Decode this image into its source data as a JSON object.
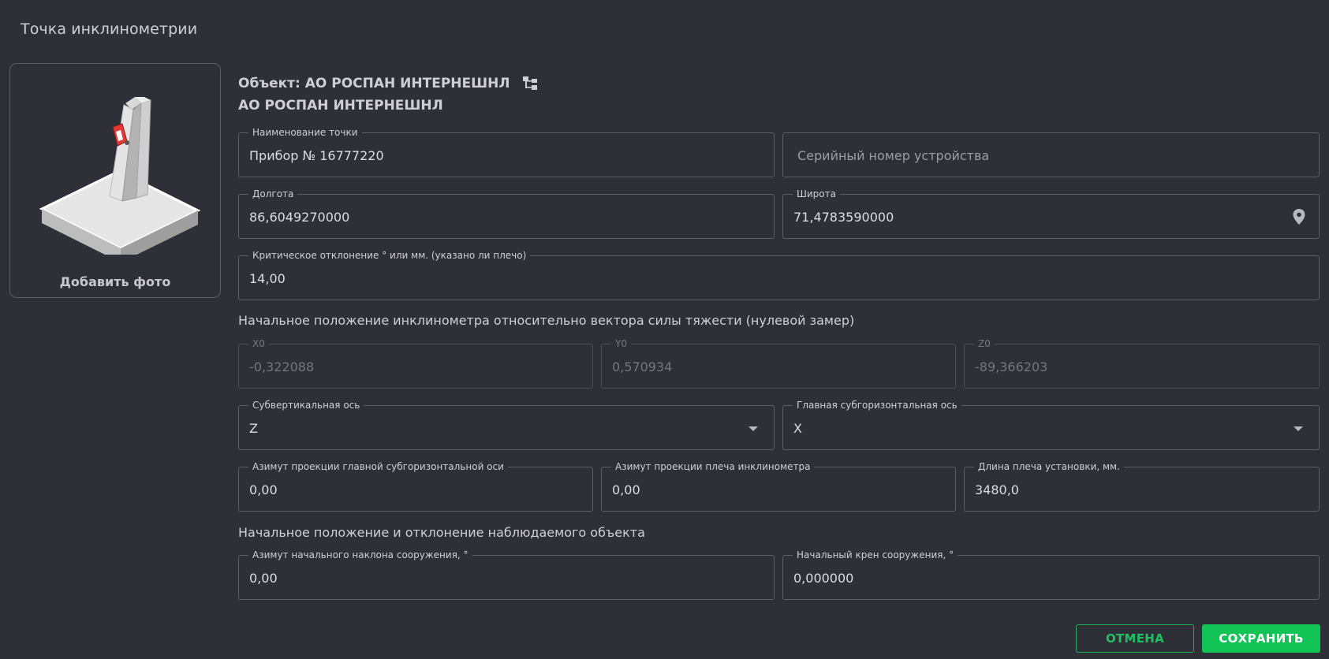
{
  "dialog": {
    "title": "Точка инклинометрии"
  },
  "photo": {
    "label": "Добавить фото"
  },
  "object": {
    "line1": "Объект: АО РОСПАН ИНТЕРНЕШНЛ",
    "line2": "АО РОСПАН ИНТЕРНЕШНЛ",
    "tree_icon": "hierarchy-icon"
  },
  "fields": {
    "point_name": {
      "label": "Наименование точки",
      "value": "Прибор № 16777220"
    },
    "serial": {
      "placeholder": "Серийный номер устройства"
    },
    "longitude": {
      "label": "Долгота",
      "value": "86,6049270000"
    },
    "latitude": {
      "label": "Широта",
      "value": "71,4783590000",
      "icon": "map-pin-icon"
    },
    "critical": {
      "label": "Критическое отклонение ° или мм. (указано ли плечо)",
      "value": "14,00"
    },
    "x0": {
      "label": "X0",
      "value": "-0,322088"
    },
    "y0": {
      "label": "Y0",
      "value": "0,570934"
    },
    "z0": {
      "label": "Z0",
      "value": "-89,366203"
    },
    "subvertical": {
      "label": "Субвертикальная ось",
      "value": "Z"
    },
    "main_subhorizontal": {
      "label": "Главная субгоризонтальная ось",
      "value": "X"
    },
    "azimuth_main": {
      "label": "Азимут проекции главной субгоризонтальной оси",
      "value": "0,00"
    },
    "azimuth_arm": {
      "label": "Азимут проекции плеча инклинометра",
      "value": "0,00"
    },
    "arm_length": {
      "label": "Длина плеча установки, мм.",
      "value": "3480,0"
    },
    "azimuth_tilt": {
      "label": "Азимут начального наклона сооружения, °",
      "value": "0,00"
    },
    "roll": {
      "label": "Начальный крен сооружения, °",
      "value": "0,000000"
    }
  },
  "sections": {
    "initial_position": "Начальное положение инклинометра относительно вектора силы тяжести (нулевой замер)",
    "observed_object": "Начальное положение и отклонение наблюдаемого объекта"
  },
  "buttons": {
    "cancel": "ОТМЕНА",
    "save": "СОХРАНИТЬ"
  },
  "colors": {
    "background": "#2f3037",
    "accent": "#12c456",
    "border": "#5d5e66"
  }
}
